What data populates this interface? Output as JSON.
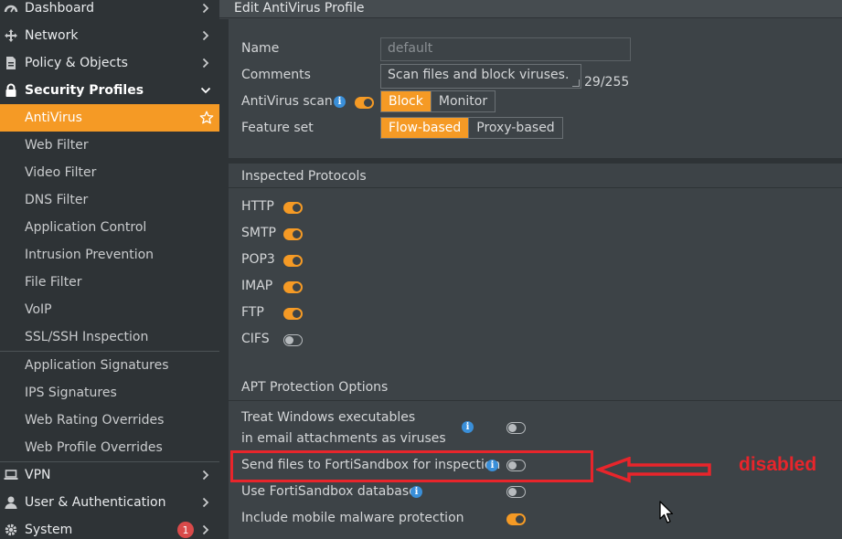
{
  "sidebar": {
    "top_items": [
      {
        "label": "Dashboard"
      },
      {
        "label": "Network"
      },
      {
        "label": "Policy & Objects"
      }
    ],
    "section": {
      "label": "Security Profiles"
    },
    "profile_items": [
      {
        "label": "AntiVirus"
      },
      {
        "label": "Web Filter"
      },
      {
        "label": "Video Filter"
      },
      {
        "label": "DNS Filter"
      },
      {
        "label": "Application Control"
      },
      {
        "label": "Intrusion Prevention"
      },
      {
        "label": "File Filter"
      },
      {
        "label": "VoIP"
      },
      {
        "label": "SSL/SSH Inspection"
      }
    ],
    "signature_items": [
      {
        "label": "Application Signatures"
      },
      {
        "label": "IPS Signatures"
      },
      {
        "label": "Web Rating Overrides"
      },
      {
        "label": "Web Profile Overrides"
      }
    ],
    "bottom_items": [
      {
        "label": "VPN"
      },
      {
        "label": "User & Authentication"
      },
      {
        "label": "System",
        "badge": "1"
      }
    ]
  },
  "header": {
    "title": "Edit AntiVirus Profile"
  },
  "form": {
    "name_label": "Name",
    "name_placeholder": "default",
    "comments_label": "Comments",
    "comments_value": "Scan files and block viruses.",
    "comments_counter": "29/255",
    "av_scan_label": "AntiVirus scan",
    "av_scan_enabled": true,
    "av_scan_options": [
      "Block",
      "Monitor"
    ],
    "av_scan_selected": "Block",
    "feature_set_label": "Feature set",
    "feature_set_options": [
      "Flow-based",
      "Proxy-based"
    ],
    "feature_set_selected": "Flow-based"
  },
  "protocols": {
    "title": "Inspected Protocols",
    "items": [
      {
        "label": "HTTP",
        "enabled": true
      },
      {
        "label": "SMTP",
        "enabled": true
      },
      {
        "label": "POP3",
        "enabled": true
      },
      {
        "label": "IMAP",
        "enabled": true
      },
      {
        "label": "FTP",
        "enabled": true
      },
      {
        "label": "CIFS",
        "enabled": false
      }
    ]
  },
  "apt": {
    "title": "APT Protection Options",
    "treat_windows_line1": "Treat Windows executables",
    "treat_windows_line2": "in email attachments as viruses",
    "treat_windows_enabled": false,
    "send_fortisandbox": "Send files to FortiSandbox for inspection",
    "send_fortisandbox_enabled": false,
    "use_fortisandbox_db": "Use FortiSandbox database",
    "use_fortisandbox_db_enabled": false,
    "mobile_malware": "Include mobile malware protection",
    "mobile_malware_enabled": true
  },
  "annotation": {
    "text": "disabled",
    "color": "#e8252b"
  },
  "colors": {
    "accent": "#f59a25",
    "info": "#3a8fd9",
    "sidebar_bg": "#2e3336",
    "panel_bg": "#3d4347"
  }
}
